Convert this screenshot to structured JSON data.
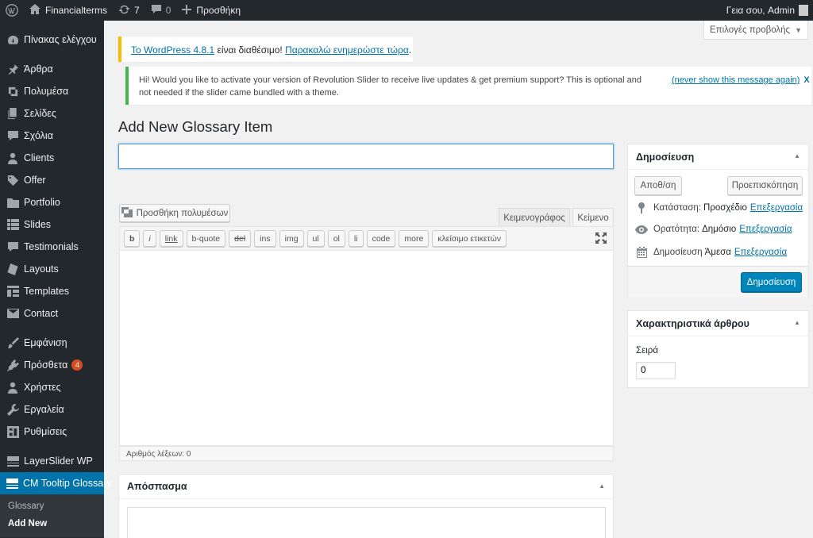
{
  "adminbar": {
    "site_name": "Financialterms",
    "updates_count": "7",
    "comments_count": "0",
    "new_label": "Προσθήκη",
    "greeting": "Γεια σου, Admin"
  },
  "sidebar": {
    "items": [
      {
        "label": "Πίνακας ελέγχου",
        "icon": "dashboard-icon"
      },
      {
        "label": "Άρθρα",
        "icon": "pin-icon"
      },
      {
        "label": "Πολυμέσα",
        "icon": "media-icon"
      },
      {
        "label": "Σελίδες",
        "icon": "pages-icon"
      },
      {
        "label": "Σχόλια",
        "icon": "comments-icon"
      },
      {
        "label": "Clients",
        "icon": "user-icon"
      },
      {
        "label": "Offer",
        "icon": "tag-icon"
      },
      {
        "label": "Portfolio",
        "icon": "folder-icon"
      },
      {
        "label": "Slides",
        "icon": "slides-icon"
      },
      {
        "label": "Testimonials",
        "icon": "quote-icon"
      },
      {
        "label": "Layouts",
        "icon": "layout-icon"
      },
      {
        "label": "Templates",
        "icon": "templates-icon"
      },
      {
        "label": "Contact",
        "icon": "mail-icon"
      },
      {
        "label": "Εμφάνιση",
        "icon": "brush-icon"
      },
      {
        "label": "Πρόσθετα",
        "icon": "plugin-icon",
        "badge": "4"
      },
      {
        "label": "Χρήστες",
        "icon": "users-icon"
      },
      {
        "label": "Εργαλεία",
        "icon": "wrench-icon"
      },
      {
        "label": "Ρυθμίσεις",
        "icon": "settings-icon"
      },
      {
        "label": "LayerSlider WP",
        "icon": "layers-icon"
      },
      {
        "label": "CM Tooltip Glossary",
        "icon": "glossary-icon"
      }
    ],
    "submenu": [
      "Glossary",
      "Add New"
    ]
  },
  "screen_options": {
    "label": "Επιλογές προβολής"
  },
  "notices": {
    "update": {
      "link1": "Το WordPress 4.8.1",
      "text": " είναι διαθέσιμο! ",
      "link2": "Παρακαλώ ενημερώστε τώρα",
      "end": "."
    },
    "revslider": {
      "message": "Hi! Would you like to activate your version of Revolution Slider to receive live updates & get premium support? This is optional and not needed if the slider came bundled with a theme.",
      "dismiss": "(never show this message again)",
      "close": "X"
    }
  },
  "page": {
    "title": "Add New Glossary Item",
    "title_value": ""
  },
  "editor": {
    "add_media": "Προσθήκη πολυμέσων",
    "tab_visual": "Κειμενογράφος",
    "tab_text": "Κείμενο",
    "quicktags": [
      "b",
      "i",
      "link",
      "b-quote",
      "del",
      "ins",
      "img",
      "ul",
      "ol",
      "li",
      "code",
      "more",
      "κλείσιμο ετικετών"
    ],
    "word_count": "Αριθμός λέξεων: 0"
  },
  "excerpt": {
    "title": "Απόσπασμα"
  },
  "publish": {
    "title": "Δημοσίευση",
    "save_draft": "Αποθ/ση",
    "preview": "Προεπισκόπηση",
    "status_label": "Κατάσταση:",
    "status_value": "Προσχέδιο",
    "visibility_label": "Ορατότητα:",
    "visibility_value": "Δημόσιο",
    "schedule_label": "Δημοσίευση",
    "schedule_value": "Άμεσα",
    "edit": "Επεξεργασία",
    "publish_button": "Δημοσίευση"
  },
  "attributes": {
    "title": "Χαρακτηριστικά άρθρου",
    "order_label": "Σειρά",
    "order_value": "0"
  },
  "colors": {
    "accent": "#0073aa",
    "adminbar": "#23282d",
    "publish": "#0085ba",
    "warning": "#ffb900",
    "success": "#46b450"
  }
}
